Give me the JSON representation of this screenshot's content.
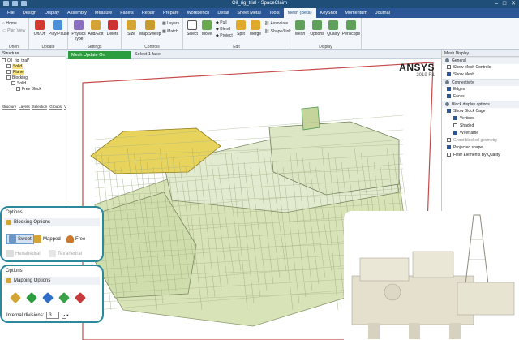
{
  "window": {
    "title": "Oil_rig_trial - SpaceClaim",
    "controls": [
      "–",
      "□",
      "✕"
    ]
  },
  "tabs": [
    "File",
    "Design",
    "Display",
    "Assembly",
    "Measure",
    "Facets",
    "Repair",
    "Prepare",
    "Workbench",
    "Detail",
    "Sheet Metal",
    "Tools",
    "Mesh (Beta)",
    "KeyShot",
    "Momentum",
    "Journal"
  ],
  "active_tab": "Mesh (Beta)",
  "ribbon": {
    "orient": {
      "label": "Orient",
      "home": "Home",
      "plan_view": "Plan View"
    },
    "update": {
      "label": "Update",
      "onoff": "On/Off",
      "play_pause": "Play/Pause"
    },
    "settings": {
      "label": "Settings",
      "physics_type": "Physics Type",
      "add_edit": "Add/Edit",
      "delete": "Delete"
    },
    "controls": {
      "label": "Controls",
      "size": "Size",
      "map_sweep": "Map/Sweep",
      "layers": "Layers",
      "match": "Match"
    },
    "edit": {
      "label": "Edit",
      "select": "Select",
      "move": "Move",
      "pull": "Pull",
      "blend": "Blend",
      "project": "Project",
      "split": "Split",
      "merge": "Merge",
      "associate": "Associate",
      "shape_link": "Shape/Link"
    },
    "display": {
      "label": "Display",
      "mesh": "Mesh",
      "options": "Options",
      "quality": "Quality",
      "periscope": "Periscope"
    }
  },
  "structure": {
    "header": "Structure",
    "tree": [
      {
        "label": "Oil_rig_trial*",
        "level": 0,
        "highlight": false
      },
      {
        "label": "Solid",
        "level": 1,
        "highlight": true
      },
      {
        "label": "Plane",
        "level": 1,
        "highlight": true
      },
      {
        "label": "Blocking",
        "level": 1,
        "highlight": false
      },
      {
        "label": "Solid",
        "level": 2,
        "highlight": false
      },
      {
        "label": "Free Block",
        "level": 3,
        "highlight": false
      }
    ],
    "bottom_tabs": [
      "Structure",
      "Layers",
      "Selection",
      "Groups",
      "Views"
    ]
  },
  "viewport": {
    "tab": "Mesh Update On",
    "status": "Select 1 face",
    "brand": "ANSYS",
    "version": "2019 R1"
  },
  "mesh_display": {
    "header": "Mesh Display",
    "sections": [
      {
        "title": "General",
        "rows": [
          {
            "label": "Show Mesh Controls",
            "checked": false,
            "indent": false,
            "gray": false
          },
          {
            "label": "Show Mesh",
            "checked": true,
            "indent": false,
            "gray": false
          }
        ]
      },
      {
        "title": "Connectivity",
        "rows": [
          {
            "label": "Edges",
            "checked": true,
            "indent": false,
            "gray": false
          },
          {
            "label": "Faces",
            "checked": true,
            "indent": false,
            "gray": false
          }
        ]
      },
      {
        "title": "Block display options",
        "rows": [
          {
            "label": "Show Block Cage",
            "checked": true,
            "indent": false,
            "gray": false
          },
          {
            "label": "Vertices",
            "checked": true,
            "indent": true,
            "gray": false
          },
          {
            "label": "Shaded",
            "checked": false,
            "indent": true,
            "gray": false
          },
          {
            "label": "Wireframe",
            "checked": true,
            "indent": true,
            "gray": false
          },
          {
            "label": "Ghost blocked geometry",
            "checked": false,
            "indent": false,
            "gray": true
          },
          {
            "label": "Projected shape",
            "checked": true,
            "indent": false,
            "gray": false
          },
          {
            "label": "Filter Elements By Quality",
            "checked": false,
            "indent": false,
            "gray": false
          }
        ]
      }
    ]
  },
  "blocking_options": {
    "title": "Options",
    "subtitle": "Blocking Options",
    "swept": "Swept",
    "mapped": "Mapped",
    "free": "Free",
    "hexahedral": "Hexahedral",
    "tetrahedral": "Tetrahedral"
  },
  "mapping_options": {
    "title": "Options",
    "subtitle": "Mapping Options",
    "internal_divisions_label": "Internal divisions:",
    "internal_divisions_value": "3"
  },
  "colors": {
    "accent": "#2b5797",
    "mesh_fill": "#d8e3b7",
    "mesh_line": "#8a9a6d",
    "selected_face": "#e8d35d",
    "callout_border": "#2a8a9b",
    "status_green": "#2c9e3f"
  }
}
